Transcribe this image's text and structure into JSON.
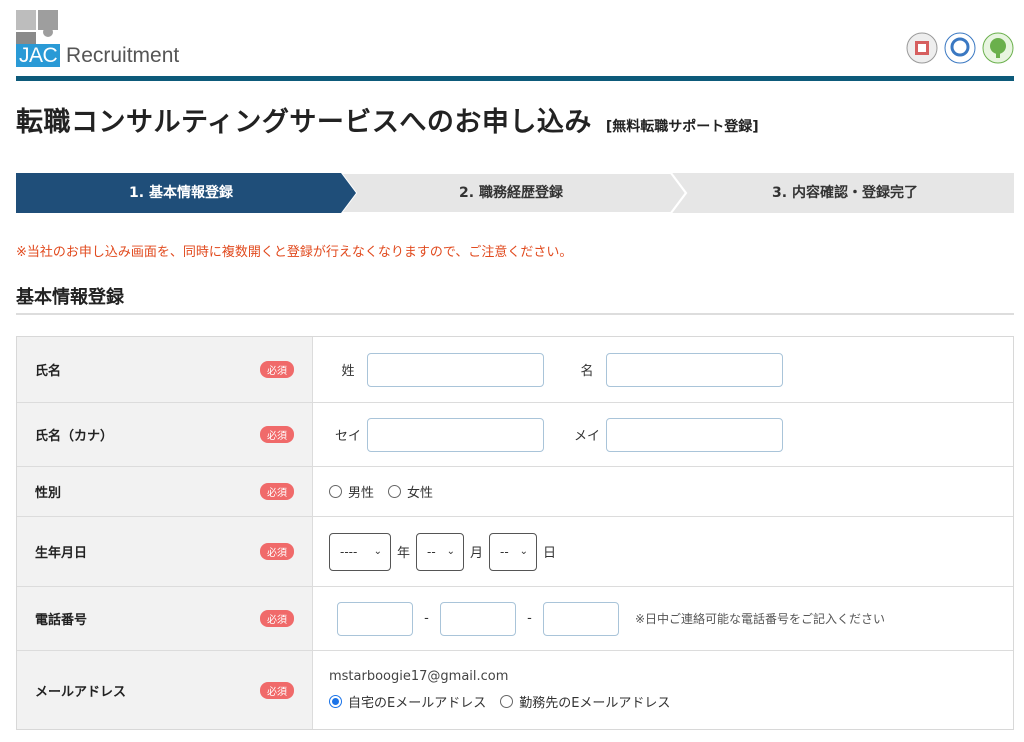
{
  "header": {
    "logo_brand": "JAC",
    "logo_word": "Recruitment",
    "badges": [
      "privacy-badge",
      "privacy-mark-badge",
      "eco-badge"
    ]
  },
  "title": {
    "main": "転職コンサルティングサービスへのお申し込み",
    "sub": "[無料転職サポート登録]"
  },
  "steps": [
    {
      "label": "1. 基本情報登録",
      "active": true
    },
    {
      "label": "2. 職務経歴登録",
      "active": false
    },
    {
      "label": "3. 内容確認・登録完了",
      "active": false
    }
  ],
  "notice": "※当社のお申し込み画面を、同時に複数開くと登録が行えなくなりますので、ご注意ください。",
  "section_title": "基本情報登録",
  "required_label": "必須",
  "form": {
    "name": {
      "label": "氏名",
      "last": "姓",
      "first": "名"
    },
    "kana": {
      "label": "氏名（カナ）",
      "last": "セイ",
      "first": "メイ"
    },
    "gender": {
      "label": "性別",
      "options": [
        "男性",
        "女性"
      ]
    },
    "birth": {
      "label": "生年月日",
      "year": "----",
      "year_unit": "年",
      "month": "--",
      "month_unit": "月",
      "day": "--",
      "day_unit": "日"
    },
    "phone": {
      "label": "電話番号",
      "sep": "-",
      "note": "※日中ご連絡可能な電話番号をご記入ください"
    },
    "mail": {
      "label": "メールアドレス",
      "address": "mstarboogie17@gmail.com",
      "options": [
        "自宅のEメールアドレス",
        "勤務先のEメールアドレス"
      ],
      "selected": 0
    }
  },
  "colors": {
    "accent": "#1f4e79",
    "header_rule": "#0d5a7a",
    "notice": "#e14a1e",
    "required": "#f06a6a"
  }
}
